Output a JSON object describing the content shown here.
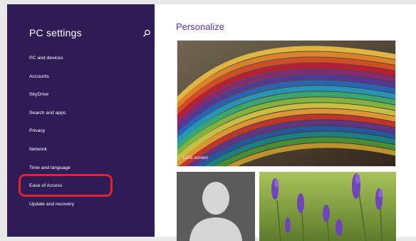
{
  "sidebar": {
    "title": "PC settings",
    "items": [
      {
        "label": "PC and devices"
      },
      {
        "label": "Accounts"
      },
      {
        "label": "SkyDrive"
      },
      {
        "label": "Search and apps"
      },
      {
        "label": "Privacy"
      },
      {
        "label": "Network"
      },
      {
        "label": "Time and language"
      },
      {
        "label": "Ease of Access"
      },
      {
        "label": "Update and recovery"
      }
    ],
    "highlighted_item": "Ease of Access"
  },
  "main": {
    "title": "Personalize",
    "lock_screen_label": "Lock screen"
  },
  "colors": {
    "sidebar_bg": "#2f1b55",
    "accent": "#5a2fa3",
    "highlight": "#e3232c"
  },
  "icons": {
    "search": "search-icon",
    "account": "user-silhouette-icon"
  }
}
